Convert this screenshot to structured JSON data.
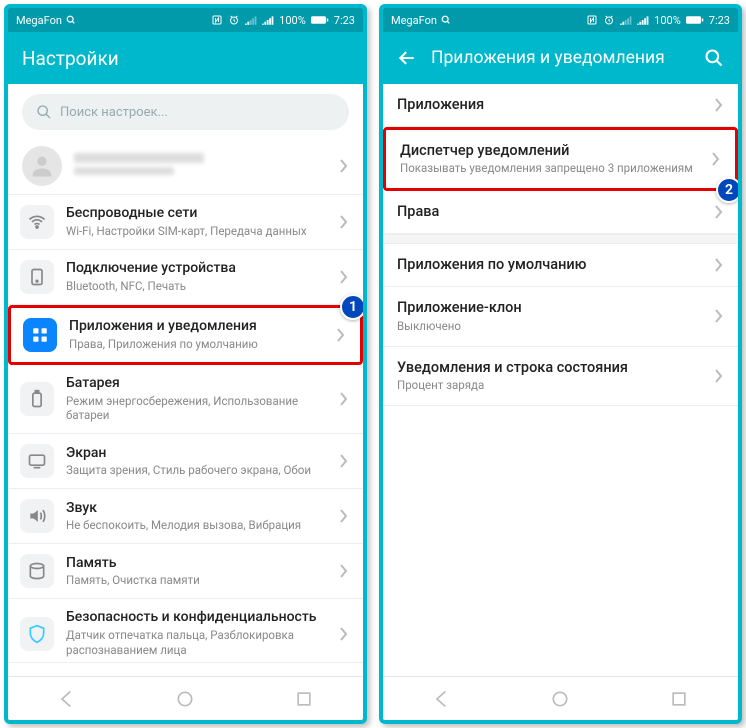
{
  "status": {
    "carrier": "MegaFon",
    "battery": "100%",
    "time": "7:23"
  },
  "left": {
    "title": "Настройки",
    "search_placeholder": "Поиск настроек...",
    "items": [
      {
        "title": "Беспроводные сети",
        "sub": "Wi-Fi, Настройки SIM-карт, Передача данных"
      },
      {
        "title": "Подключение устройства",
        "sub": "Bluetooth, NFC, Печать"
      },
      {
        "title": "Приложения и уведомления",
        "sub": "Права, Приложения по умолчанию"
      },
      {
        "title": "Батарея",
        "sub": "Режим энергосбережения, Использование батареи"
      },
      {
        "title": "Экран",
        "sub": "Защита зрения, Стиль рабочего экрана, Обои"
      },
      {
        "title": "Звук",
        "sub": "Не беспокоить, Мелодия вызова, Вибрация"
      },
      {
        "title": "Память",
        "sub": "Память, Очистка памяти"
      },
      {
        "title": "Безопасность и конфиденциальность",
        "sub": "Датчик отпечатка пальца, Разблокировка распознаванием лица"
      }
    ],
    "badge": "1"
  },
  "right": {
    "title": "Приложения и уведомления",
    "items": [
      {
        "title": "Приложения",
        "sub": ""
      },
      {
        "title": "Диспетчер уведомлений",
        "sub": "Показывать уведомления запрещено 3 приложениям"
      },
      {
        "title": "Права",
        "sub": ""
      },
      {
        "title": "Приложения по умолчанию",
        "sub": ""
      },
      {
        "title": "Приложение-клон",
        "sub": "Выключено"
      },
      {
        "title": "Уведомления и строка состояния",
        "sub": "Процент заряда"
      }
    ],
    "badge": "2"
  }
}
